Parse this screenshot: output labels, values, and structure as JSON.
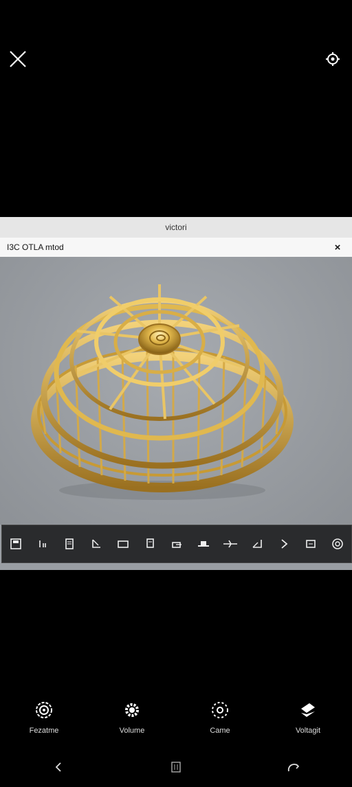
{
  "viewer": {
    "title": "victori",
    "header_label": "I3C OTLA mtod",
    "close_glyph": "×"
  },
  "toolbar": {
    "items": [
      "save-icon",
      "text-icon",
      "document-icon",
      "crop-icon",
      "frame-icon",
      "layers-icon",
      "export-icon",
      "hat-icon",
      "arrow-icon",
      "rotate-icon",
      "next-icon",
      "edit-icon",
      "target-icon"
    ]
  },
  "options": [
    {
      "label": "Fezatme",
      "icon": "spiral-icon"
    },
    {
      "label": "Volume",
      "icon": "gear-icon"
    },
    {
      "label": "Came",
      "icon": "orbit-icon"
    },
    {
      "label": "Voltagit",
      "icon": "layers-icon"
    }
  ],
  "colors": {
    "gold": "#d8ad3f",
    "gold_dark": "#8a6418",
    "viewer_bg": "#9a9ea3",
    "toolbar_bg": "#2a2b2d"
  }
}
